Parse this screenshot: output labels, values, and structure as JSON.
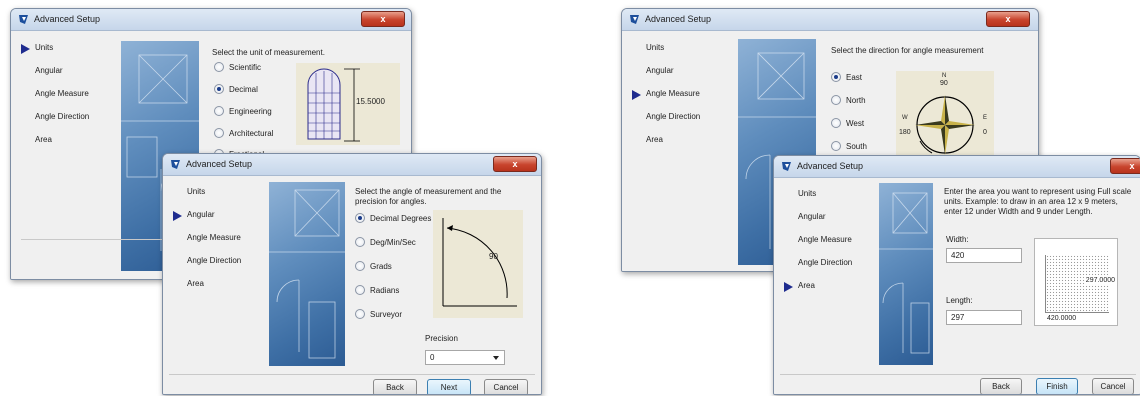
{
  "app_title": "Advanced Setup",
  "close_glyph": "x",
  "nav": [
    "Units",
    "Angular",
    "Angle Measure",
    "Angle Direction",
    "Area"
  ],
  "w1": {
    "active": "Units",
    "prompt": "Select the unit of measurement.",
    "options": [
      "Scientific",
      "Decimal",
      "Engineering",
      "Architectural",
      "Fractional"
    ],
    "selected": "Decimal",
    "preview_value": "15.5000"
  },
  "w2": {
    "active": "Angular",
    "prompt": "Select the angle of measurement and the precision for angles.",
    "options": [
      "Decimal Degrees",
      "Deg/Min/Sec",
      "Grads",
      "Radians",
      "Surveyor"
    ],
    "selected": "Decimal Degrees",
    "preview_value": "90",
    "precision_label": "Precision",
    "precision_value": "0",
    "buttons": {
      "back": "Back",
      "next": "Next",
      "cancel": "Cancel"
    }
  },
  "w3": {
    "active": "Angle Measure",
    "prompt": "Select the direction for angle measurement",
    "options": [
      "East",
      "North",
      "West",
      "South"
    ],
    "selected": "East",
    "compass": {
      "n": "N",
      "s": "S",
      "e": "E",
      "w": "W",
      "north_deg": "90",
      "west_deg": "180",
      "south_deg": "270",
      "east_deg": "0"
    }
  },
  "w4": {
    "active": "Area",
    "prompt": "Enter the area you want to represent using Full scale units. Example: to draw in an area 12 x 9 meters, enter 12 under Width and 9 under Length.",
    "width_label": "Width:",
    "width_value": "420",
    "length_label": "Length:",
    "length_value": "297",
    "sheet_width": "420.0000",
    "sheet_length": "297.0000",
    "buttons": {
      "back": "Back",
      "finish": "Finish",
      "cancel": "Cancel"
    }
  },
  "colors": {
    "accent": "#1f2c8f",
    "close": "#c8442d",
    "blueprint": "#4a7bb0",
    "preview_bg": "#ece8d6"
  }
}
